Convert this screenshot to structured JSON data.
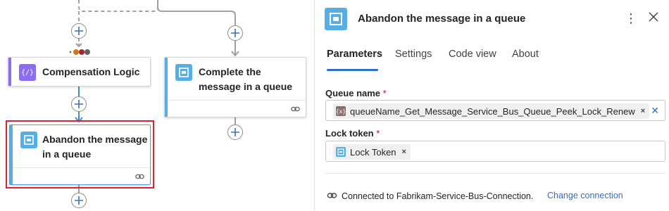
{
  "canvas": {
    "cards": [
      {
        "title_lines": [
          "Compensation Logic"
        ],
        "icon": "scope-icon",
        "accent": "#8c6cf0"
      },
      {
        "title_lines": [
          "Complete the",
          "message in a queue"
        ],
        "icon": "service-bus-icon",
        "accent": "#55aee5"
      },
      {
        "title_lines": [
          "Abandon the message",
          "in a queue"
        ],
        "icon": "service-bus-icon",
        "accent": "#55aee5",
        "selected": true
      }
    ],
    "run_after_dot_colors": [
      "#c97b1e",
      "#a4262c",
      "#616161"
    ]
  },
  "panel": {
    "title": "Abandon the message in a queue",
    "tabs": [
      "Parameters",
      "Settings",
      "Code view",
      "About"
    ],
    "active_tab": "Parameters",
    "fields": [
      {
        "label": "Queue name",
        "required": "*",
        "token": "queueName_Get_Message_Service_Bus_Queue_Peek_Lock_Renew",
        "token_icon": "variable-icon"
      },
      {
        "label": "Lock token",
        "required": "*",
        "token": "Lock Token",
        "token_icon": "service-bus-icon"
      }
    ],
    "connection_text": "Connected to Fabrikam-Service-Bus-Connection.",
    "change_connection": "Change connection"
  },
  "colors": {
    "accent_blue": "#2f6fc8",
    "service_bus": "#55aee5",
    "scope_purple": "#8c6cf0",
    "selection_red": "#d9232e"
  }
}
